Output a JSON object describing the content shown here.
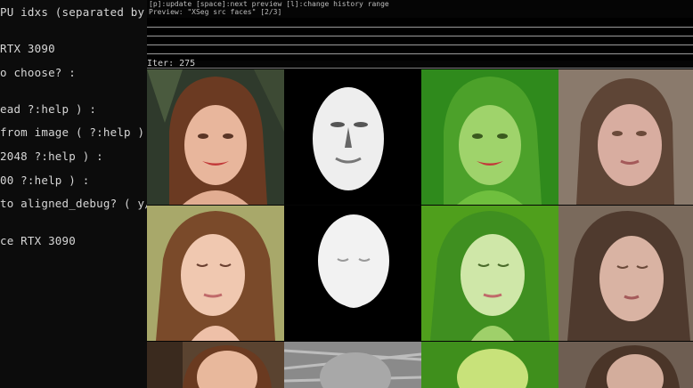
{
  "terminal": {
    "lines": [
      "PU idxs (separated by comma",
      "RTX 3090",
      "o choose? :",
      "ead ?:help ) :",
      " from image ( ?:help ) :",
      "2048 ?:help ) :",
      "00 ?:help ) :",
      "to aligned_debug? ( y/n ) :",
      "ce RTX 3090"
    ]
  },
  "preview": {
    "hint_line": "[p]:update [space]:next preview [l]:change history range",
    "title_line": "Preview: \"XSeg src faces\" [2/3]",
    "iter_label": "Iter: 275",
    "columns": [
      "source-image",
      "predicted-mask",
      "mask-overlay",
      "reconstruction"
    ],
    "colors": {
      "overlay": "#35b020",
      "mask": "#ffffff",
      "background": "#000000"
    }
  }
}
